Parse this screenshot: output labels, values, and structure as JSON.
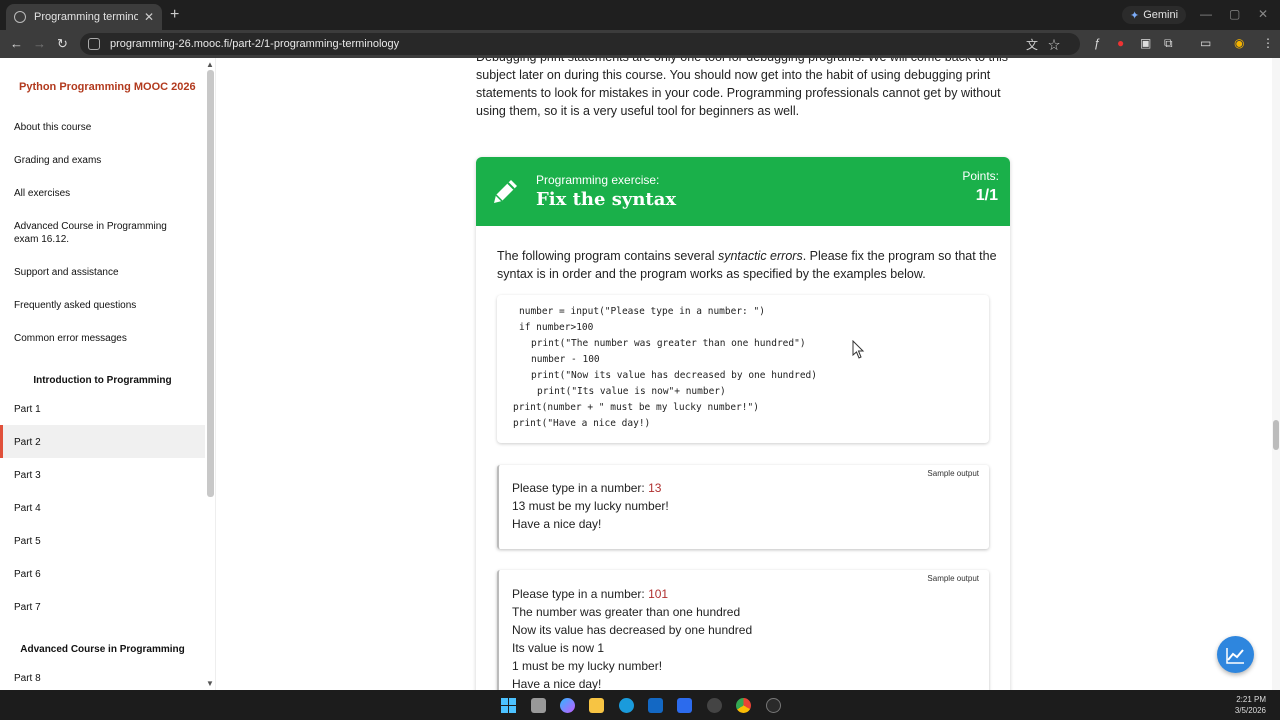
{
  "browser": {
    "tab_title": "Programming terminology - Py",
    "url": "programming-26.mooc.fi/part-2/1-programming-terminology",
    "gemini_label": "Gemini"
  },
  "sidebar": {
    "title": "Python Programming MOOC 2026",
    "items": [
      {
        "label": "About this course"
      },
      {
        "label": "Grading and exams"
      },
      {
        "label": "All exercises"
      },
      {
        "label": "Advanced Course in Programming exam 16.12."
      },
      {
        "label": "Support and assistance"
      },
      {
        "label": "Frequently asked questions"
      },
      {
        "label": "Common error messages"
      }
    ],
    "section1": "Introduction to Programming",
    "parts": [
      "Part 1",
      "Part 2",
      "Part 3",
      "Part 4",
      "Part 5",
      "Part 6",
      "Part 7"
    ],
    "section2": "Advanced Course in Programming",
    "parts2": [
      "Part 8"
    ]
  },
  "content": {
    "intro": "Debugging print statements are only one tool for debugging programs. We will come back to this subject later on during this course. You should now get into the habit of using debugging print statements to look for mistakes in your code. Programming professionals cannot get by without using them, so it is a very useful tool for beginners as well.",
    "exercise": {
      "label": "Programming exercise:",
      "title": "Fix the syntax",
      "points_label": "Points:",
      "points_value": "1/1",
      "desc_a": "The following program contains several ",
      "desc_em": "syntactic errors",
      "desc_b": ". Please fix the program so that the syntax is in order and the program works as specified by the examples below."
    },
    "code_lines": [
      "number = input(\"Please type in a number: \")",
      "if number>100",
      "print(\"The number was greater than one hundred\")",
      "number - 100",
      "print(\"Now its value has decreased by one hundred)",
      "print(\"Its value is now\"+ number)",
      "print(number + \" must be my lucky number!\")",
      "print(\"Have a nice day!)"
    ],
    "sample_label": "Sample output",
    "sample1": {
      "prompt": "Please type in a number: ",
      "input": "13",
      "lines": [
        "13 must be my lucky number!",
        "Have a nice day!"
      ]
    },
    "sample2": {
      "prompt": "Please type in a number: ",
      "input": "101",
      "lines": [
        "The number was greater than one hundred",
        "Now its value has decreased by one hundred",
        "Its value is now 1",
        "1 must be my lucky number!",
        "Have a nice day!"
      ]
    }
  },
  "taskbar": {
    "time": "2:21 PM",
    "date": "3/5/2026"
  },
  "colors": {
    "accent_green": "#1ab04a",
    "brand_red": "#b23a1e",
    "fab_blue": "#2e86de"
  }
}
